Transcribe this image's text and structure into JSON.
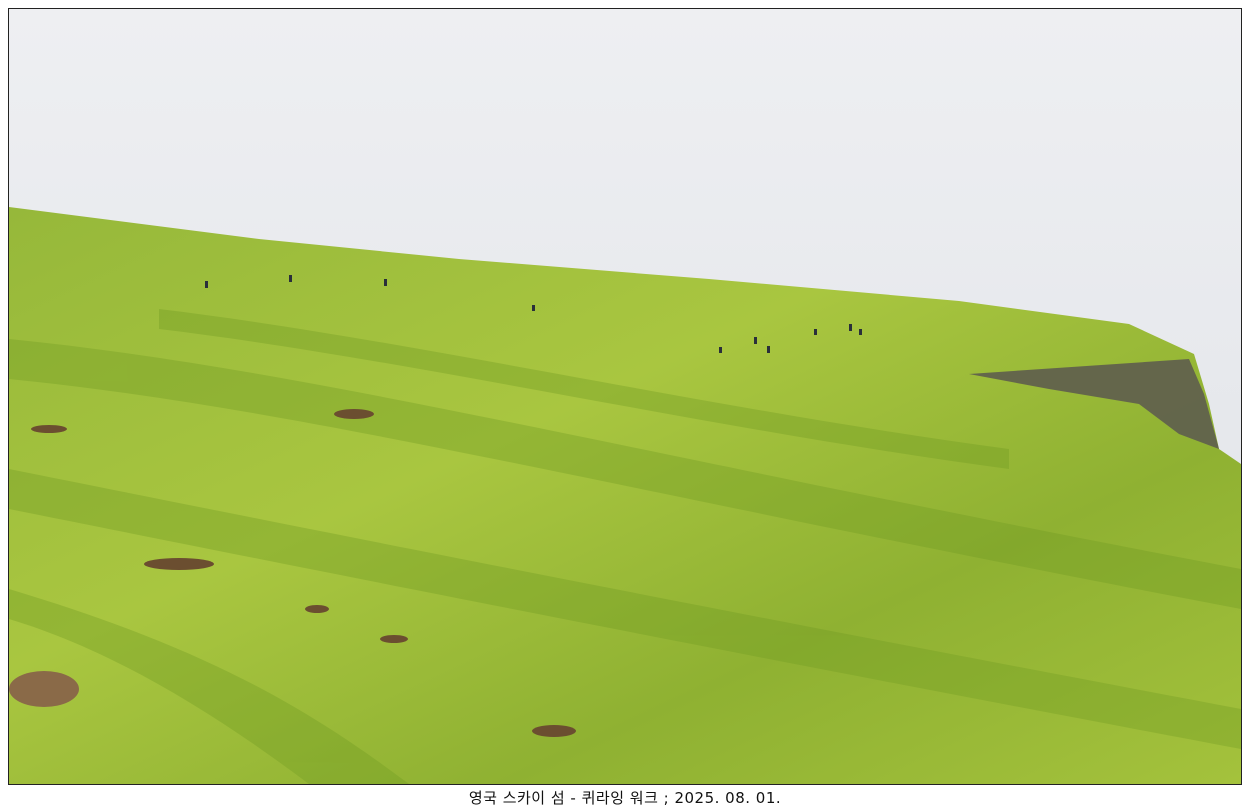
{
  "photo": {
    "subject": "grassy hillside",
    "colors": {
      "sky": "#e6e8ec",
      "grass_light": "#a8c53a",
      "grass_dark": "#6f9a22",
      "cliff": "#5b5a4c",
      "soil": "#7a5a3a"
    }
  },
  "caption": "영국 스카이 섬 - 퀴라잉 워크 ; 2025. 08. 01."
}
